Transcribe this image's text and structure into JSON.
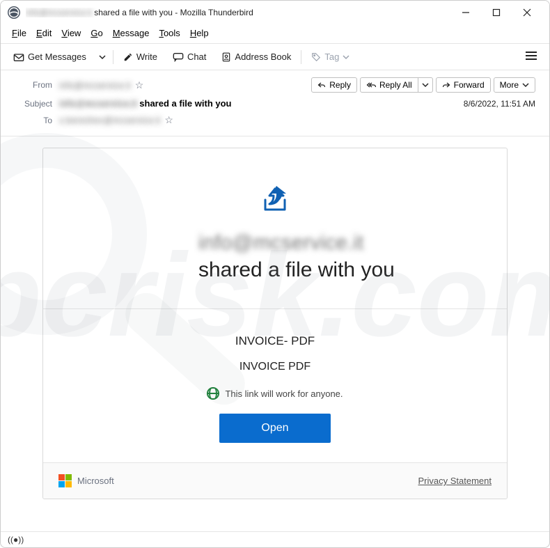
{
  "window": {
    "title_prefix_redacted": "info@mcservice.it",
    "title_suffix": " shared a file with you - Mozilla Thunderbird"
  },
  "menubar": {
    "file": "File",
    "edit": "Edit",
    "view": "View",
    "go": "Go",
    "message": "Message",
    "tools": "Tools",
    "help": "Help"
  },
  "toolbar": {
    "get_messages": "Get Messages",
    "write": "Write",
    "chat": "Chat",
    "address_book": "Address Book",
    "tag": "Tag"
  },
  "header": {
    "labels": {
      "from": "From",
      "subject": "Subject",
      "to": "To"
    },
    "from_value_redacted": "info@mcservice.it",
    "subject_prefix_redacted": "info@mcservice.it",
    "subject_suffix": " shared a file with you",
    "to_value_redacted": "s.bereshev@mcservice.it",
    "datetime": "8/6/2022, 11:51 AM",
    "actions": {
      "reply": "Reply",
      "reply_all": "Reply All",
      "forward": "Forward",
      "more": "More"
    }
  },
  "email": {
    "heading_prefix_redacted": "info@mcservice.it",
    "heading_suffix": " shared a file with you",
    "file_name": "INVOICE- PDF",
    "file_desc": "INVOICE PDF",
    "link_scope": "This link will work for anyone.",
    "open_button": "Open",
    "footer_brand": "Microsoft",
    "privacy": "Privacy Statement"
  },
  "statusbar": {
    "icon_label": "((●))"
  },
  "watermark": {
    "text": "pcrisk.com"
  }
}
